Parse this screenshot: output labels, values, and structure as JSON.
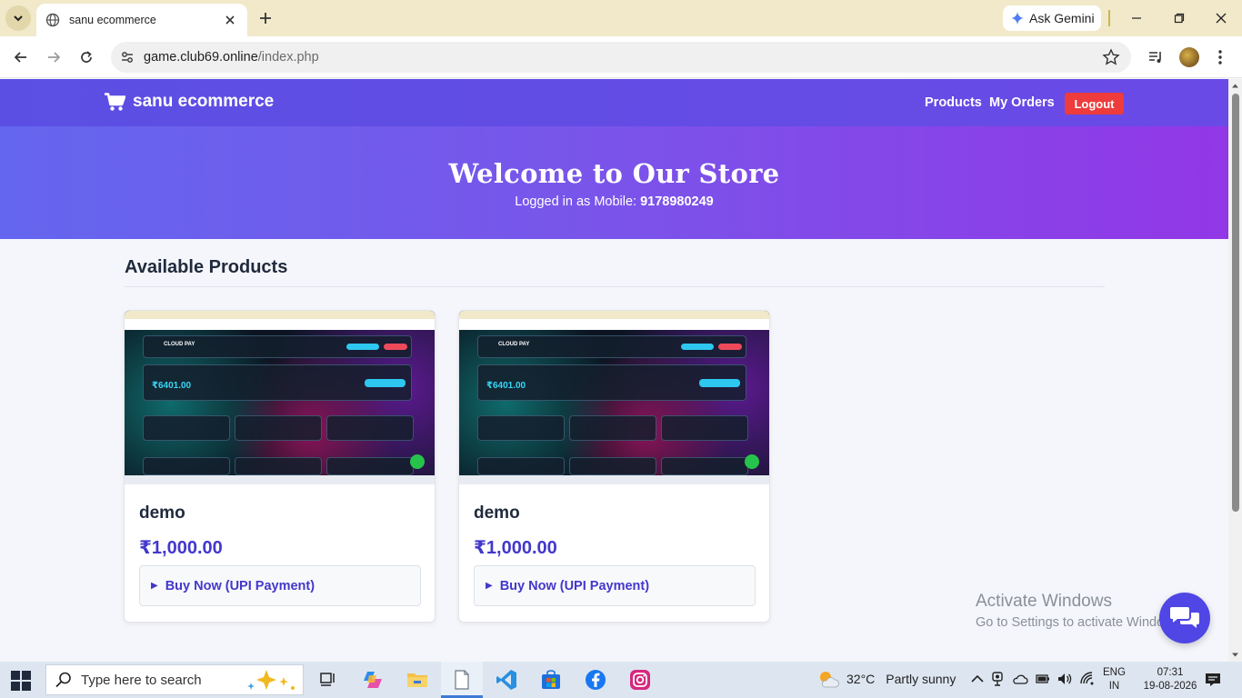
{
  "browser": {
    "tab_title": "sanu ecommerce",
    "gemini_label": "Ask Gemini",
    "url_host": "game.club69.online",
    "url_path": "/index.php"
  },
  "site": {
    "brand": "sanu ecommerce",
    "nav": {
      "products": "Products",
      "orders": "My Orders",
      "logout": "Logout"
    },
    "hero_title": "Welcome to Our Store",
    "hero_sub_prefix": "Logged in as Mobile: ",
    "hero_mobile": "9178980249",
    "section_title": "Available Products",
    "products": [
      {
        "name": "demo",
        "price": "₹1,000.00",
        "buy_label": "Buy Now (UPI Payment)"
      },
      {
        "name": "demo",
        "price": "₹1,000.00",
        "buy_label": "Buy Now (UPI Payment)"
      }
    ],
    "thumbnail": {
      "app_name": "CLOUD PAY",
      "balance": "₹6401.00"
    }
  },
  "watermark": {
    "line1": "Activate Windows",
    "line2": "Go to Settings to activate Windows."
  },
  "taskbar": {
    "search_placeholder": "Type here to search",
    "temperature": "32°C",
    "weather": "Partly sunny",
    "lang1": "ENG",
    "lang2": "IN",
    "time": "07:31",
    "date": "19-08-2026"
  },
  "colors": {
    "navbar": "#5b4fe3",
    "hero_start": "#6466ef",
    "hero_end": "#9237e6",
    "logout": "#ee3b3b",
    "price": "#4338ca",
    "chat_fab": "#4f46e5"
  }
}
